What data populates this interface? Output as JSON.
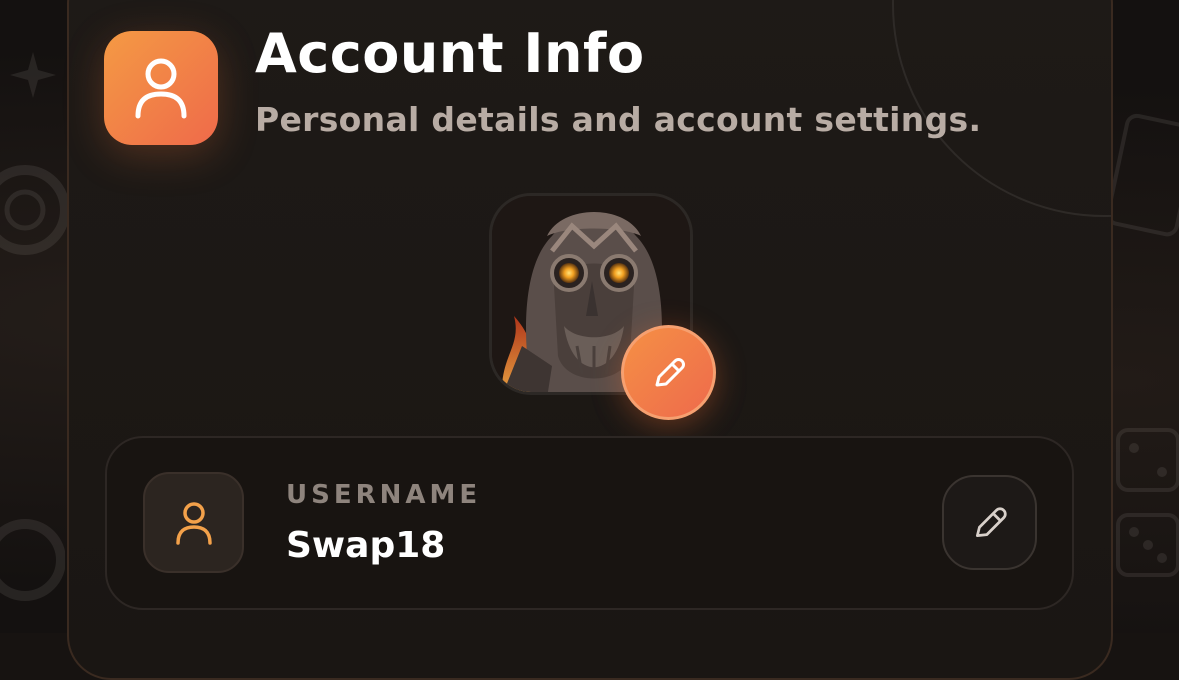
{
  "header": {
    "title": "Account Info",
    "subtitle": "Personal details and account settings.",
    "icon": "user-icon"
  },
  "avatar": {
    "image": "fantasy-warrior-avatar",
    "edit_icon": "pencil-icon"
  },
  "fields": [
    {
      "label": "USERNAME",
      "value": "Swap18",
      "icon": "user-icon",
      "edit_icon": "pencil-icon"
    }
  ],
  "colors": {
    "accent_start": "#f49a44",
    "accent_end": "#ef6a4a",
    "background": "#141110",
    "card": "#1c1815",
    "text_primary": "#ffffff",
    "text_secondary": "#b8aca4"
  }
}
